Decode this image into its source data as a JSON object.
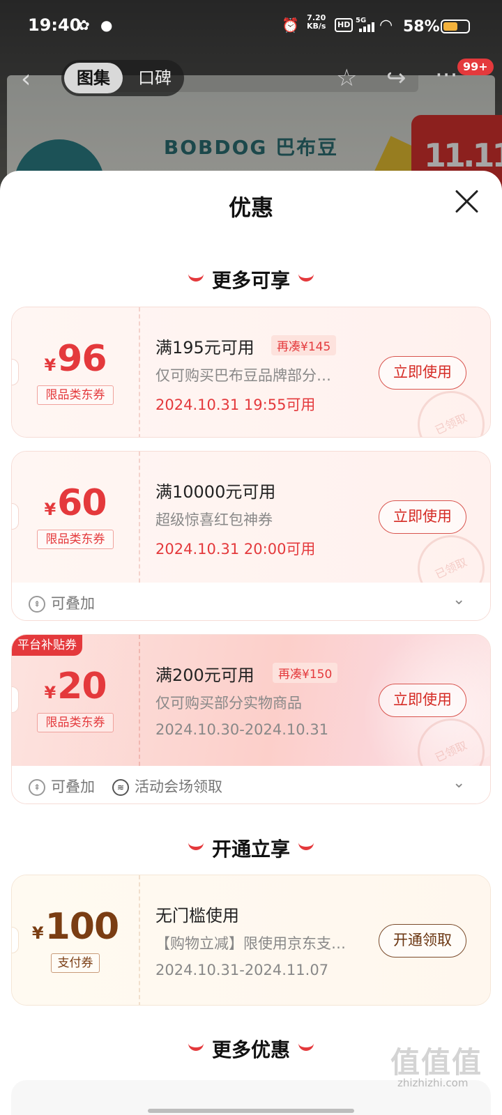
{
  "status_bar": {
    "time": "19:40",
    "net_speed_value": "7.20",
    "net_speed_unit": "KB/s",
    "hd": "HD",
    "network": "5G",
    "battery": "58%",
    "icons": [
      "wechat-icon",
      "chat-bubble-icon",
      "alarm-icon",
      "signal-icon",
      "wifi-icon",
      "battery-icon"
    ]
  },
  "nav": {
    "tabs": [
      {
        "label": "图集",
        "active": true
      },
      {
        "label": "口碑",
        "active": false
      }
    ],
    "badge": "99+",
    "icons": [
      "back-icon",
      "star-icon",
      "share-icon",
      "more-icon"
    ]
  },
  "background": {
    "brand": "BOBDOG 巴布豆"
  },
  "sheet": {
    "title": "优惠"
  },
  "sections": {
    "more_available": "更多可享",
    "open_enjoy": "开通立享",
    "more_offers": "更多优惠"
  },
  "coupons": [
    {
      "yen": "¥",
      "amount": "96",
      "tag": "限品类东券",
      "title": "满195元可用",
      "extra": "再凑¥145",
      "desc": "仅可购买巴布豆品牌部分…",
      "date": "2024.10.31 19:55可用",
      "button": "立即使用",
      "stamp": "已领取"
    },
    {
      "yen": "¥",
      "amount": "60",
      "tag": "限品类东券",
      "title": "满10000元可用",
      "desc": "超级惊喜红包神券",
      "date": "2024.10.31 20:00可用",
      "button": "立即使用",
      "stamp": "已领取",
      "footer": [
        "可叠加"
      ]
    },
    {
      "corner": "平台补贴券",
      "yen": "¥",
      "amount": "20",
      "tag": "限品类东券",
      "title": "满200元可用",
      "extra": "再凑¥150",
      "desc": "仅可购买部分实物商品",
      "date": "2024.10.30-2024.10.31",
      "button": "立即使用",
      "stamp": "已领取",
      "footer": [
        "可叠加",
        "活动会场领取"
      ]
    },
    {
      "yen": "¥",
      "amount": "100",
      "tag": "支付券",
      "title": "无门槛使用",
      "desc": "【购物立减】限使用京东支…",
      "date": "2024.10.31-2024.11.07",
      "button": "开通领取"
    }
  ],
  "watermark": {
    "logo": "值值值",
    "url": "zhizhizhi.com"
  },
  "colors": {
    "accent": "#e4393c",
    "brown": "#7a3d13",
    "date_red": "#e4393c"
  }
}
